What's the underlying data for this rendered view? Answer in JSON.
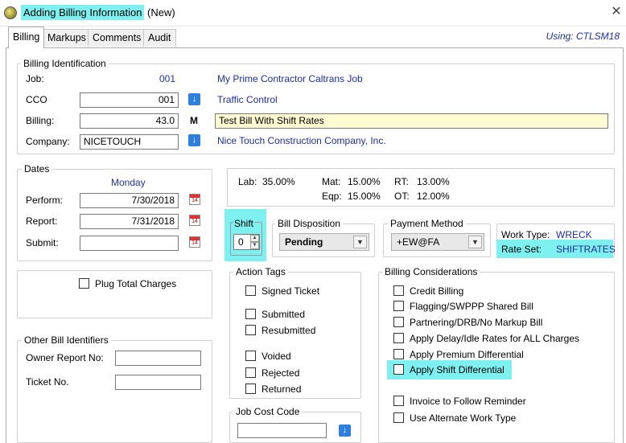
{
  "window": {
    "title_highlight": "Adding Billing Information",
    "title_suffix": "(New)",
    "close_glyph": "✕"
  },
  "tabs": [
    "Billing",
    "Markups",
    "Comments",
    "Audit"
  ],
  "using": "Using: CTLSM18",
  "billing_identification": {
    "legend": "Billing Identification",
    "job_label": "Job:",
    "job_value": "001",
    "job_desc": "My Prime Contractor Caltrans Job",
    "cco_label": "CCO",
    "cco_value": "001",
    "cco_desc": "Traffic Control",
    "billing_label": "Billing:",
    "billing_value": "43.0",
    "billing_flag": "M",
    "billing_desc": "Test Bill With Shift Rates",
    "company_label": "Company:",
    "company_value": "NICETOUCH",
    "company_desc": "Nice Touch Construction Company, Inc."
  },
  "dates": {
    "legend": "Dates",
    "day": "Monday",
    "perform_label": "Perform:",
    "perform_value": "7/30/2018",
    "report_label": "Report:",
    "report_value": "7/31/2018",
    "submit_label": "Submit:",
    "submit_value": ""
  },
  "rates": {
    "lab_label": "Lab:",
    "lab_value": "35.00%",
    "mat_label": "Mat:",
    "mat_value": "15.00%",
    "rt_label": "RT:",
    "rt_value": "13.00%",
    "eqp_label": "Eqp:",
    "eqp_value": "15.00%",
    "ot_label": "OT:",
    "ot_value": "12.00%"
  },
  "shift": {
    "legend": "Shift",
    "value": "0"
  },
  "bill_disposition": {
    "legend": "Bill Disposition",
    "value": "Pending"
  },
  "payment_method": {
    "legend": "Payment Method",
    "value": "+EW@FA"
  },
  "work_type": {
    "label": "Work Type:",
    "value": "WRECK",
    "rate_set_label": "Rate Set:",
    "rate_set_value": "SHIFTRATES"
  },
  "plug_total": {
    "label": "Plug Total Charges",
    "checked": false
  },
  "other_bill_identifiers": {
    "legend": "Other Bill Identifiers",
    "owner_report_label": "Owner Report No:",
    "owner_report_value": "",
    "ticket_label": "Ticket No.",
    "ticket_value": ""
  },
  "action_tags": {
    "legend": "Action Tags",
    "items": [
      "Signed Ticket",
      "Submitted",
      "Resubmitted",
      "Voided",
      "Rejected",
      "Returned"
    ]
  },
  "job_cost_code": {
    "legend": "Job Cost Code",
    "value": ""
  },
  "billing_considerations": {
    "legend": "Billing Considerations",
    "items": [
      "Credit Billing",
      "Flagging/SWPPP Shared Bill",
      "Partnering/DRB/No Markup Bill",
      "Apply Delay/Idle Rates for ALL Charges",
      "Apply Premium Differential",
      "Apply Shift Differential",
      "Invoice to Follow Reminder",
      "Use Alternate Work Type"
    ]
  },
  "icons": {
    "lookup": "arrow-down-lookup-icon",
    "calendar": "calendar-14-icon",
    "dropdown": "chevron-down-icon",
    "calendar_day": "14"
  },
  "colors": {
    "highlight": "#7ff0f0",
    "link_text": "#1f2f9e",
    "lookup_button": "#2d7fe0",
    "active_field": "#fffbd2"
  }
}
